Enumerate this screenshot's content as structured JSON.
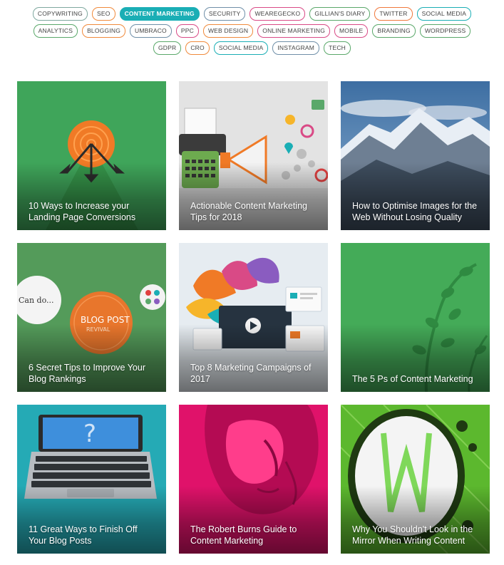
{
  "tags": [
    {
      "label": "Copywriting",
      "color": "#7fa89f"
    },
    {
      "label": "SEO",
      "color": "#f08a3c"
    },
    {
      "label": "Content Marketing",
      "color": "#1aaeb5",
      "active": true
    },
    {
      "label": "Security",
      "color": "#6f8fa8"
    },
    {
      "label": "WeAreGecko",
      "color": "#d94a86"
    },
    {
      "label": "Gillian's Diary",
      "color": "#5aa86a"
    },
    {
      "label": "Twitter",
      "color": "#f0783c"
    },
    {
      "label": "Social Media",
      "color": "#1aaeb5"
    },
    {
      "label": "Analytics",
      "color": "#5aa86a"
    },
    {
      "label": "Blogging",
      "color": "#f08a3c"
    },
    {
      "label": "Umbraco",
      "color": "#6f8fa8"
    },
    {
      "label": "PPC",
      "color": "#d94a86"
    },
    {
      "label": "Web Design",
      "color": "#f08a3c"
    },
    {
      "label": "Online Marketing",
      "color": "#d94a86"
    },
    {
      "label": "Mobile",
      "color": "#d94a86"
    },
    {
      "label": "Branding",
      "color": "#5aa86a"
    },
    {
      "label": "WordPress",
      "color": "#5aa86a"
    },
    {
      "label": "GDPR",
      "color": "#5aa86a"
    },
    {
      "label": "CRO",
      "color": "#f08a3c"
    },
    {
      "label": "Social Media",
      "color": "#1aaeb5"
    },
    {
      "label": "Instagram",
      "color": "#6f8fa8"
    },
    {
      "label": "Tech",
      "color": "#5aa86a"
    }
  ],
  "posts": [
    {
      "title": "10 Ways to Increase your Landing Page Conversions",
      "image": "target-arrows-illustration"
    },
    {
      "title": "Actionable Content Marketing Tips for 2018",
      "image": "typewriter-megaphone-illustration"
    },
    {
      "title": "How to Optimise Images for the Web Without Losing Quality",
      "image": "mountain-photo"
    },
    {
      "title": "6 Secret Tips to Improve Your Blog Rankings",
      "image": "blog-post-revival-badges"
    },
    {
      "title": "Top 8 Marketing Campaigns of 2017",
      "image": "video-splash-illustration"
    },
    {
      "title": "The 5 Ps of Content Marketing",
      "image": "vine-silhouette-illustration"
    },
    {
      "title": "11 Great Ways to Finish Off Your Blog Posts",
      "image": "laptop-question-photo"
    },
    {
      "title": "The Robert Burns Guide to Content Marketing",
      "image": "robert-burns-pop-art"
    },
    {
      "title": "Why You Shouldn't Look in the Mirror When Writing Content",
      "image": "ornate-mirror-illustration"
    }
  ]
}
